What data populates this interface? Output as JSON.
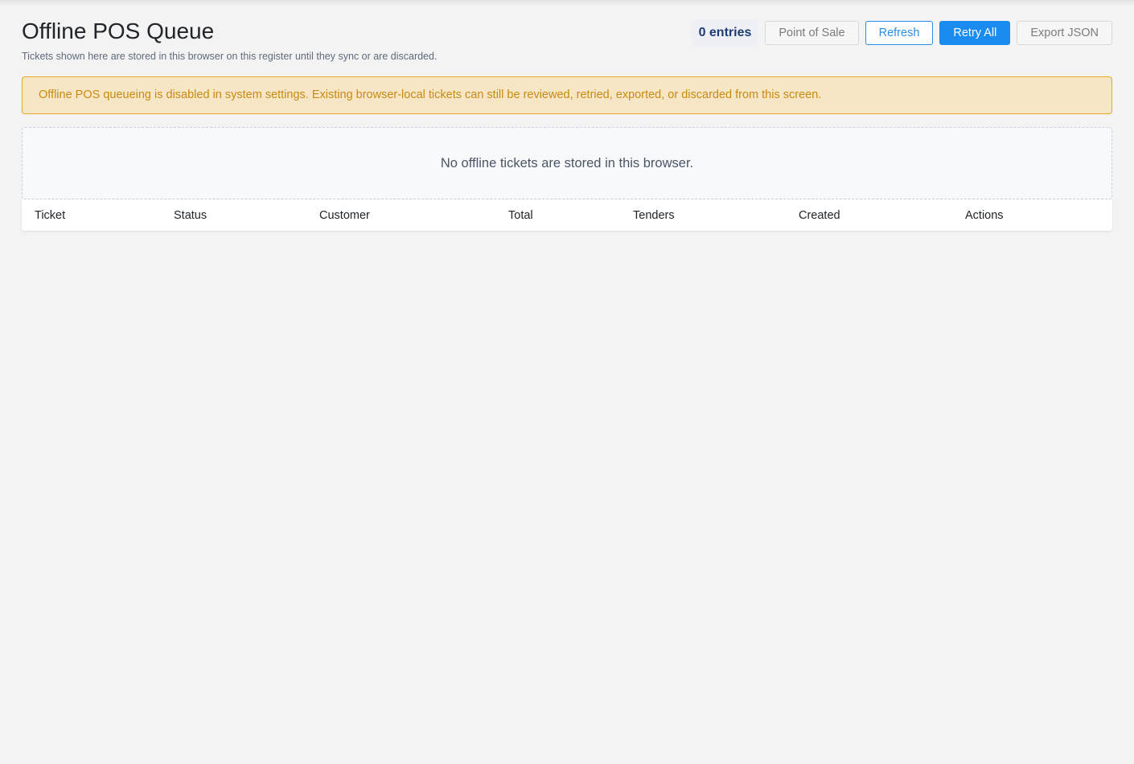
{
  "header": {
    "title": "Offline POS Queue",
    "subtitle": "Tickets shown here are stored in this browser on this register until they sync or are discarded."
  },
  "toolbar": {
    "entries_label": "0 entries",
    "point_of_sale_label": "Point of Sale",
    "refresh_label": "Refresh",
    "retry_all_label": "Retry All",
    "export_json_label": "Export JSON"
  },
  "alert": {
    "message": "Offline POS queueing is disabled in system settings. Existing browser-local tickets can still be reviewed, retried, exported, or discarded from this screen."
  },
  "empty_state": {
    "message": "No offline tickets are stored in this browser."
  },
  "table": {
    "columns": [
      "Ticket",
      "Status",
      "Customer",
      "Total",
      "Tenders",
      "Created",
      "Actions"
    ]
  },
  "colors": {
    "primary": "#1a8cf0",
    "warning_border": "#e6a92a",
    "warning_background": "#f6e6c6",
    "warning_text": "#c98a10",
    "badge_text": "#1f3c73"
  }
}
